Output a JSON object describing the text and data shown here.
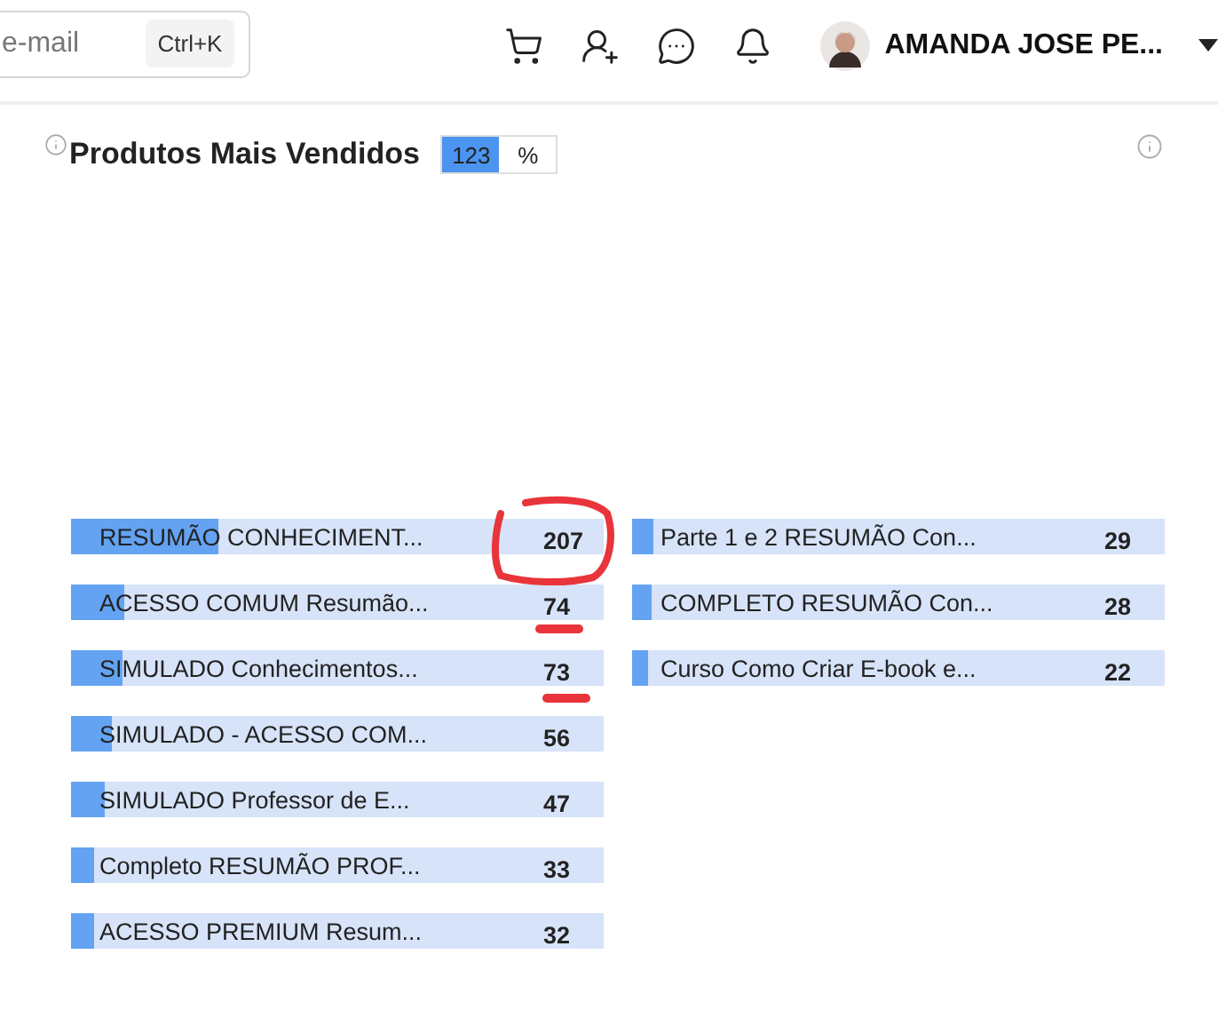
{
  "header": {
    "search": {
      "placeholder": "e-mail",
      "shortcut": "Ctrl+K"
    },
    "user": {
      "name": "AMANDA JOSE PE..."
    }
  },
  "panel": {
    "title": "Produtos Mais Vendidos",
    "toggle": [
      {
        "label": "123",
        "selected": true
      },
      {
        "label": "%",
        "selected": false
      }
    ],
    "columns": [
      [
        {
          "name": "RESUMÃO CONHECIMENT...",
          "value": "207",
          "level": 0.277
        },
        {
          "name": "ACESSO COMUM Resumão...",
          "value": "74",
          "level": 0.1
        },
        {
          "name": "SIMULADO Conhecimentos...",
          "value": "73",
          "level": 0.097
        },
        {
          "name": "SIMULADO - ACESSO COM...",
          "value": "56",
          "level": 0.075
        },
        {
          "name": "SIMULADO Professor de E...",
          "value": "47",
          "level": 0.063
        },
        {
          "name": "Completo RESUMÃO PROF...",
          "value": "33",
          "level": 0.044
        },
        {
          "name": "ACESSO PREMIUM Resum...",
          "value": "32",
          "level": 0.043
        }
      ],
      [
        {
          "name": "Parte 1 e 2 RESUMÃO Con...",
          "value": "29",
          "level": 0.039
        },
        {
          "name": "COMPLETO RESUMÃO Con...",
          "value": "28",
          "level": 0.037
        },
        {
          "name": "Curso Como Criar E-book e...",
          "value": "22",
          "level": 0.029
        }
      ]
    ]
  }
}
